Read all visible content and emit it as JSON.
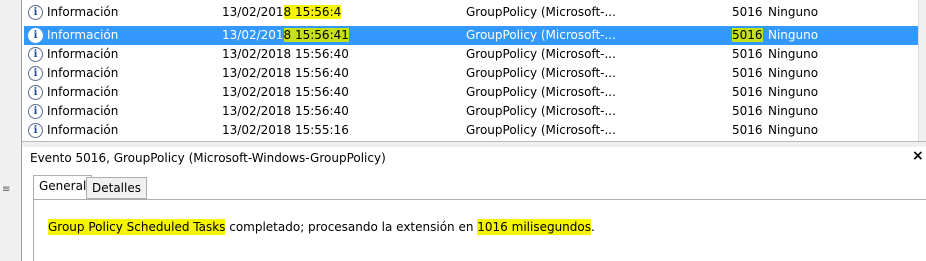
{
  "events": [
    {
      "level": "Información",
      "date_a": "13/02/201",
      "date_b": "8 15:56:4",
      "source": "GroupPolicy (Microsoft-...",
      "id": "5016",
      "task": "Ninguno",
      "selected": false
    },
    {
      "level": "Información",
      "date_a": "13/02/201",
      "date_b": "8 15:56:41",
      "source": "GroupPolicy (Microsoft-...",
      "id": "5016",
      "task": "Ninguno",
      "selected": true
    },
    {
      "level": "Información",
      "date_a": "13/02/2018 15:56:40",
      "date_b": "",
      "source": "GroupPolicy (Microsoft-...",
      "id": "5016",
      "task": "Ninguno",
      "selected": false
    },
    {
      "level": "Información",
      "date_a": "13/02/2018 15:56:40",
      "date_b": "",
      "source": "GroupPolicy (Microsoft-...",
      "id": "5016",
      "task": "Ninguno",
      "selected": false
    },
    {
      "level": "Información",
      "date_a": "13/02/2018 15:56:40",
      "date_b": "",
      "source": "GroupPolicy (Microsoft-...",
      "id": "5016",
      "task": "Ninguno",
      "selected": false
    },
    {
      "level": "Información",
      "date_a": "13/02/2018 15:56:40",
      "date_b": "",
      "source": "GroupPolicy (Microsoft-...",
      "id": "5016",
      "task": "Ninguno",
      "selected": false
    },
    {
      "level": "Información",
      "date_a": "13/02/2018 15:55:16",
      "date_b": "",
      "source": "GroupPolicy (Microsoft-...",
      "id": "5016",
      "task": "Ninguno",
      "selected": false
    }
  ],
  "detail": {
    "title": "Evento 5016, GroupPolicy (Microsoft-Windows-GroupPolicy)",
    "close": "×",
    "tabs": {
      "general": "General",
      "detalles": "Detalles"
    },
    "message": {
      "part1": "Group Policy Scheduled Tasks",
      "part2": " completado; procesando la extensión en ",
      "part3": "1016 milisegundos",
      "part4": "."
    }
  },
  "icons": {
    "info": "i",
    "grip": "≡"
  },
  "colors": {
    "selection": "#3399ff",
    "highlight": "#f5f500"
  }
}
